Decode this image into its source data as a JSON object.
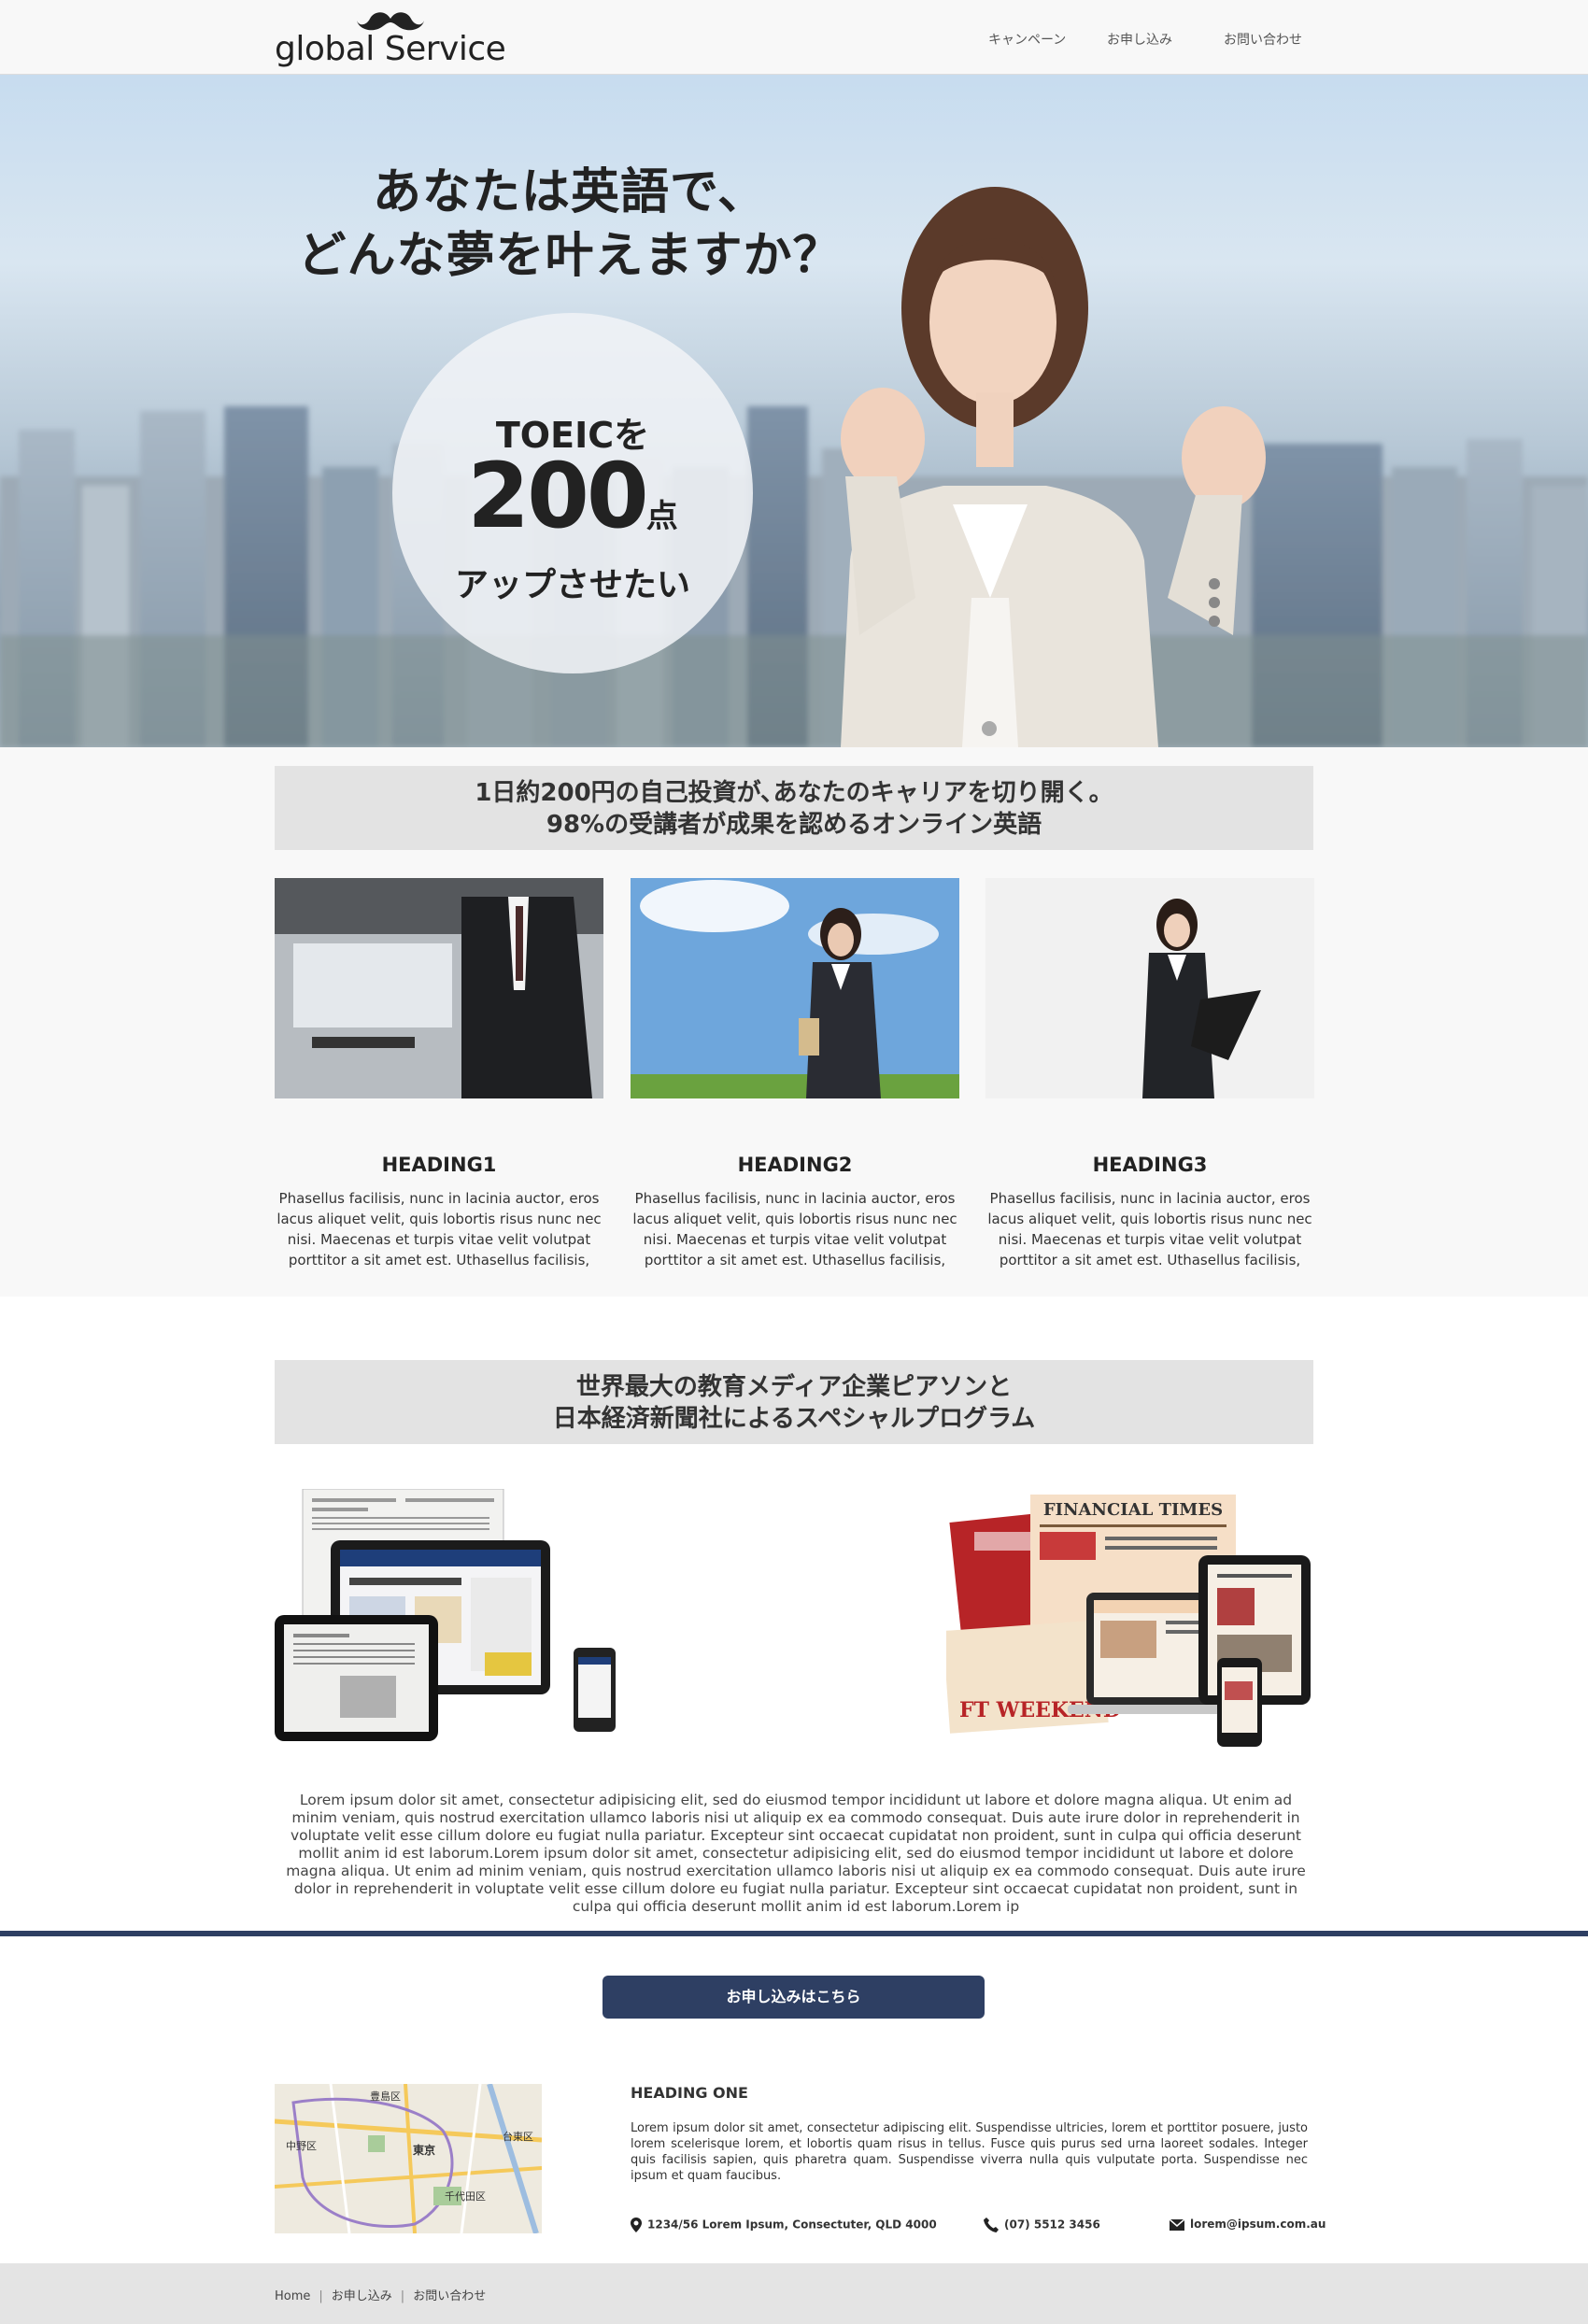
{
  "header": {
    "logo_text": "global Service",
    "nav": [
      "キャンペーン",
      "お申し込み",
      "お問い合わせ"
    ]
  },
  "hero": {
    "title_line1": "あなたは英語で、",
    "title_line2": "どんな夢を叶えますか？",
    "circle_line1": "TOEICを",
    "circle_number": "200",
    "circle_unit": "点",
    "circle_line3": "アップさせたい"
  },
  "section1": {
    "banner_line1": "1日約200円の自己投資が､あなたのキャリアを切り開く。",
    "banner_line2": "98%の受講者が成果を認めるオンライン英語",
    "cards": [
      {
        "heading": "HEADING1",
        "text": "Phasellus facilisis, nunc in lacinia auctor, eros lacus aliquet velit, quis lobortis risus nunc nec nisi. Maecenas et turpis vitae velit volutpat porttitor a sit amet est. Uthasellus facilisis,"
      },
      {
        "heading": "HEADING2",
        "text": "Phasellus facilisis, nunc in lacinia auctor, eros lacus aliquet velit, quis lobortis risus nunc nec nisi. Maecenas et turpis vitae velit volutpat porttitor a sit amet est. Uthasellus facilisis,"
      },
      {
        "heading": "HEADING3",
        "text": "Phasellus facilisis, nunc in lacinia auctor, eros lacus aliquet velit, quis lobortis risus nunc nec nisi. Maecenas et turpis vitae velit volutpat porttitor a sit amet est. Uthasellus facilisis,"
      }
    ]
  },
  "section2": {
    "banner_line1": "世界最大の教育メディア企業ピアソンと",
    "banner_line2": "日本経済新聞社によるスペシャルプログラム",
    "ft_masthead": "FINANCIAL TIMES",
    "ft_weekend": "FT WEEKEND",
    "body": "Lorem ipsum dolor sit amet, consectetur adipisicing elit, sed do eiusmod tempor incididunt ut labore et dolore magna aliqua. Ut enim ad minim veniam, quis nostrud exercitation ullamco laboris nisi ut aliquip ex ea commodo consequat. Duis aute irure dolor in reprehenderit in voluptate velit esse cillum dolore eu fugiat nulla pariatur. Excepteur sint occaecat cupidatat non proident, sunt in culpa qui officia deserunt mollit anim id est laborum.Lorem ipsum dolor sit amet, consectetur adipisicing elit, sed do eiusmod tempor incididunt ut labore et dolore magna aliqua. Ut enim ad minim veniam, quis nostrud exercitation ullamco laboris nisi ut aliquip ex ea commodo consequat. Duis aute irure dolor in reprehenderit in voluptate velit esse cillum dolore eu fugiat nulla pariatur. Excepteur sint occaecat cupidatat non proident, sunt in culpa qui officia deserunt mollit anim id est laborum.Lorem ip"
  },
  "cta": {
    "label": "お申し込みはこちら"
  },
  "contact": {
    "map_labels": [
      "豊島区",
      "中野区",
      "東京",
      "台東区",
      "千代田区"
    ],
    "heading": "HEADING ONE",
    "text": "Lorem ipsum dolor sit amet, consectetur adipiscing elit. Suspendisse ultricies, lorem et porttitor posuere, justo lorem scelerisque lorem, et lobortis quam risus in tellus. Fusce quis purus sed urna laoreet sodales. Integer quis facilisis sapien, quis pharetra quam. Suspendisse viverra nulla quis vulputate porta. Suspendisse nec ipsum et quam faucibus.",
    "address": "1234/56 Lorem Ipsum, Consectuter, QLD 4000",
    "phone": "(07) 5512 3456",
    "email": "lorem@ipsum.com.au"
  },
  "footer": {
    "links": [
      "Home",
      "お申し込み",
      "お問い合わせ"
    ],
    "separator": "|"
  },
  "colors": {
    "navy": "#2e3f63",
    "banner_gray": "#e3e3e3",
    "section_gray": "#f8f8f8",
    "footer_gray": "#e4e4e4"
  }
}
